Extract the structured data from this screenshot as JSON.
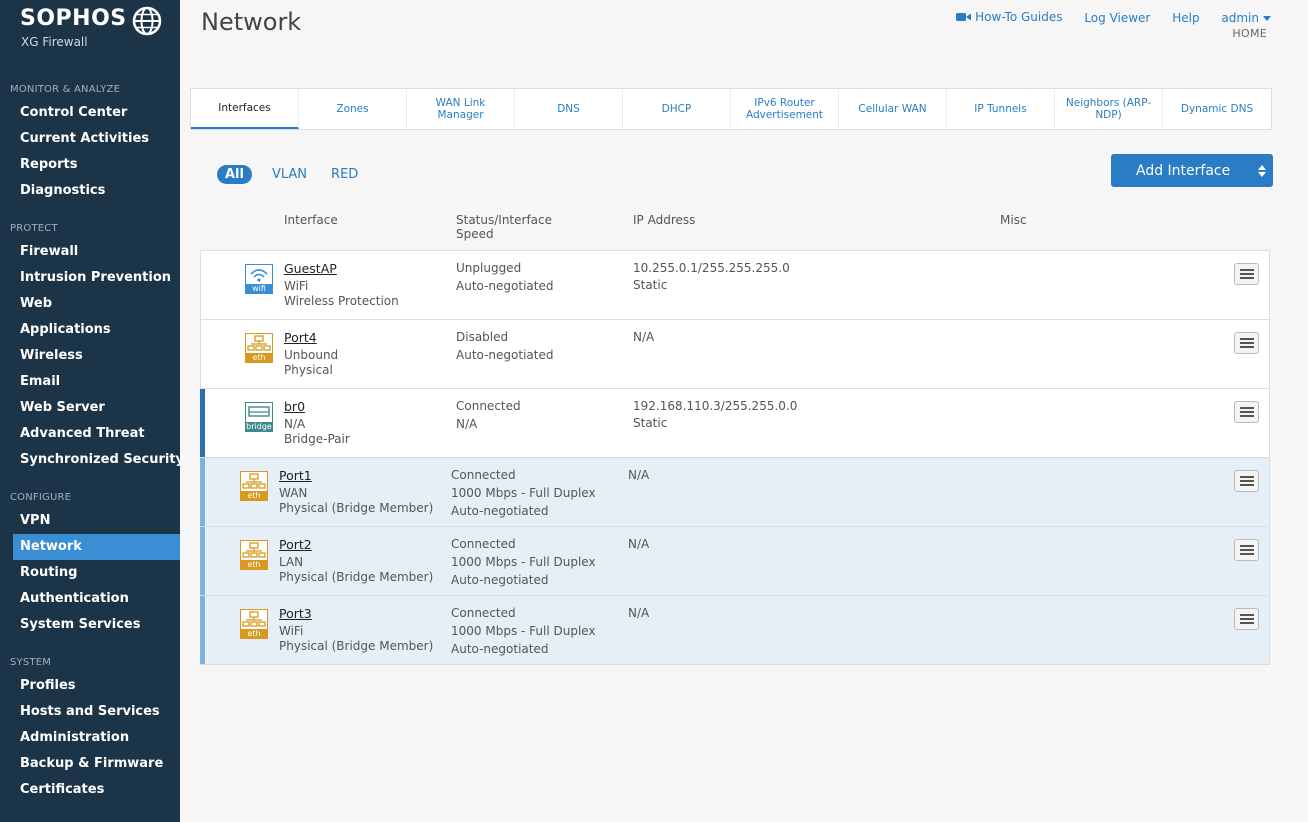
{
  "brand": {
    "name": "SOPHOS",
    "subtitle": "XG Firewall"
  },
  "sidebar": {
    "sections": [
      {
        "label": "MONITOR & ANALYZE",
        "items": [
          "Control Center",
          "Current Activities",
          "Reports",
          "Diagnostics"
        ]
      },
      {
        "label": "PROTECT",
        "items": [
          "Firewall",
          "Intrusion Prevention",
          "Web",
          "Applications",
          "Wireless",
          "Email",
          "Web Server",
          "Advanced Threat",
          "Synchronized Security"
        ]
      },
      {
        "label": "CONFIGURE",
        "items": [
          "VPN",
          "Network",
          "Routing",
          "Authentication",
          "System Services"
        ]
      },
      {
        "label": "SYSTEM",
        "items": [
          "Profiles",
          "Hosts and Services",
          "Administration",
          "Backup & Firmware",
          "Certificates"
        ]
      }
    ],
    "active": "Network"
  },
  "header": {
    "title": "Network",
    "howto": "How-To Guides",
    "log_viewer": "Log Viewer",
    "help": "Help",
    "user": "admin",
    "breadcrumb": "HOME"
  },
  "tabs": [
    "Interfaces",
    "Zones",
    "WAN Link Manager",
    "DNS",
    "DHCP",
    "IPv6 Router Advertisement",
    "Cellular WAN",
    "IP Tunnels",
    "Neighbors (ARP-NDP)",
    "Dynamic DNS"
  ],
  "active_tab": "Interfaces",
  "filters": [
    "All",
    "VLAN",
    "RED"
  ],
  "active_filter": "All",
  "add_button": "Add Interface",
  "columns": {
    "interface": "Interface",
    "status": "Status/Interface Speed",
    "ip": "IP Address",
    "misc": "Misc"
  },
  "rows": [
    {
      "icon": "wifi",
      "icon_label": "wifi",
      "name": "GuestAP",
      "line2": "WiFi",
      "line3": "Wireless Protection",
      "status": [
        "Unplugged",
        "Auto-negotiated"
      ],
      "ip": [
        "10.255.0.1/255.255.255.0",
        "Static"
      ],
      "kind": "normal"
    },
    {
      "icon": "eth",
      "icon_label": "eth",
      "name": "Port4",
      "line2": "Unbound",
      "line3": "Physical",
      "status": [
        "Disabled",
        "Auto-negotiated"
      ],
      "ip": [
        "N/A"
      ],
      "kind": "normal"
    },
    {
      "icon": "bridge",
      "icon_label": "bridge",
      "name": "br0",
      "line2": "N/A",
      "line3": "Bridge-Pair",
      "status": [
        "Connected",
        "N/A"
      ],
      "ip": [
        "192.168.110.3/255.255.0.0",
        "Static"
      ],
      "kind": "bridge"
    },
    {
      "icon": "eth",
      "icon_label": "eth",
      "name": "Port1",
      "line2": "WAN",
      "line3": "Physical (Bridge Member)",
      "status": [
        "Connected",
        "1000 Mbps - Full Duplex",
        "Auto-negotiated"
      ],
      "ip": [
        "N/A"
      ],
      "kind": "member"
    },
    {
      "icon": "eth",
      "icon_label": "eth",
      "name": "Port2",
      "line2": "LAN",
      "line3": "Physical (Bridge Member)",
      "status": [
        "Connected",
        "1000 Mbps - Full Duplex",
        "Auto-negotiated"
      ],
      "ip": [
        "N/A"
      ],
      "kind": "member"
    },
    {
      "icon": "eth",
      "icon_label": "eth",
      "name": "Port3",
      "line2": "WiFi",
      "line3": "Physical (Bridge Member)",
      "status": [
        "Connected",
        "1000 Mbps - Full Duplex",
        "Auto-negotiated"
      ],
      "ip": [
        "N/A"
      ],
      "kind": "member"
    }
  ],
  "colors": {
    "sidebar_bg": "#1c3448",
    "accent": "#2a7dc4",
    "eth_icon": "#d89a1e",
    "wifi_icon": "#3a8fd4",
    "bridge_icon": "#3f8a8f"
  }
}
